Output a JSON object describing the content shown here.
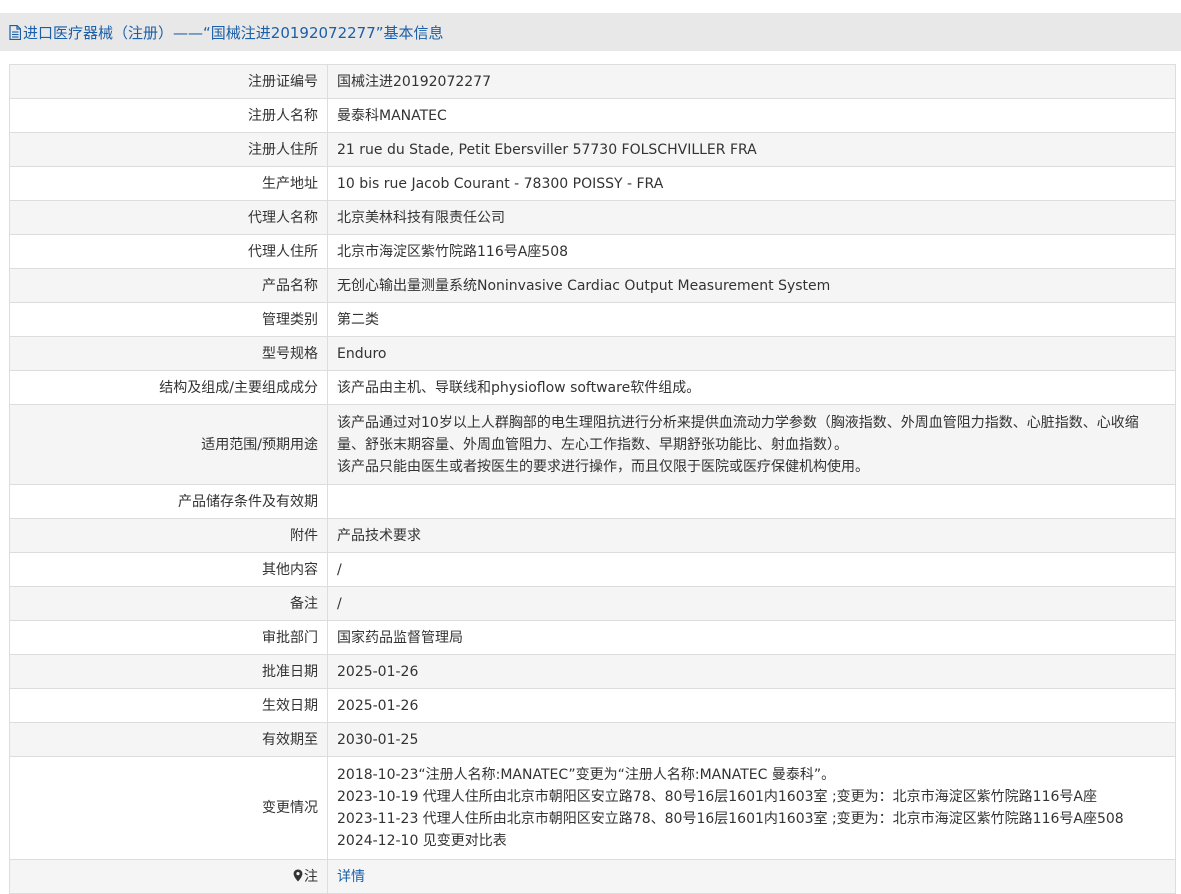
{
  "header": {
    "title": "进口医疗器械（注册）——“国械注进20192072277”基本信息",
    "title_color": "#1a5fa8",
    "icon": "document-icon"
  },
  "rows": [
    {
      "label": "注册证编号",
      "value": "国械注进20192072277"
    },
    {
      "label": "注册人名称",
      "value": "曼泰科MANATEC"
    },
    {
      "label": "注册人住所",
      "value": "21 rue du Stade, Petit Ebersviller 57730 FOLSCHVILLER FRA"
    },
    {
      "label": "生产地址",
      "value": "10 bis rue Jacob Courant - 78300 POISSY - FRA"
    },
    {
      "label": "代理人名称",
      "value": "北京美林科技有限责任公司"
    },
    {
      "label": "代理人住所",
      "value": "北京市海淀区紫竹院路116号A座508"
    },
    {
      "label": "产品名称",
      "value": "无创心输出量测量系统Noninvasive Cardiac Output Measurement System"
    },
    {
      "label": "管理类别",
      "value": "第二类"
    },
    {
      "label": "型号规格",
      "value": "Enduro"
    },
    {
      "label": "结构及组成/主要组成成分",
      "value": "该产品由主机、导联线和physioflow software软件组成。"
    },
    {
      "label": "适用范围/预期用途",
      "lines": [
        "该产品通过对10岁以上人群胸部的电生理阻抗进行分析来提供血流动力学参数（胸液指数、外周血管阻力指数、心脏指数、心收缩",
        "量、舒张末期容量、外周血管阻力、左心工作指数、早期舒张功能比、射血指数）。",
        "该产品只能由医生或者按医生的要求进行操作，而且仅限于医院或医疗保健机构使用。"
      ]
    },
    {
      "label": "产品储存条件及有效期",
      "value": ""
    },
    {
      "label": "附件",
      "value": "产品技术要求"
    },
    {
      "label": "其他内容",
      "value": "/"
    },
    {
      "label": "备注",
      "value": "/"
    },
    {
      "label": "审批部门",
      "value": "国家药品监督管理局"
    },
    {
      "label": "批准日期",
      "value": "2025-01-26"
    },
    {
      "label": "生效日期",
      "value": "2025-01-26"
    },
    {
      "label": "有效期至",
      "value": "2030-01-25"
    },
    {
      "label": "变更情况",
      "lines": [
        "2018-10-23“注册人名称:MANATEC”变更为“注册人名称:MANATEC 曼泰科”。",
        "2023-10-19 代理人住所由北京市朝阳区安立路78、80号16层1601内1603室 ;变更为：北京市海淀区紫竹院路116号A座",
        "2023-11-23 代理人住所由北京市朝阳区安立路78、80号16层1601内1603室 ;变更为：北京市海淀区紫竹院路116号A座508",
        "2024-12-10 见变更对比表"
      ]
    },
    {
      "label": "注",
      "icon": "location-pin-icon",
      "link": "详情"
    }
  ]
}
